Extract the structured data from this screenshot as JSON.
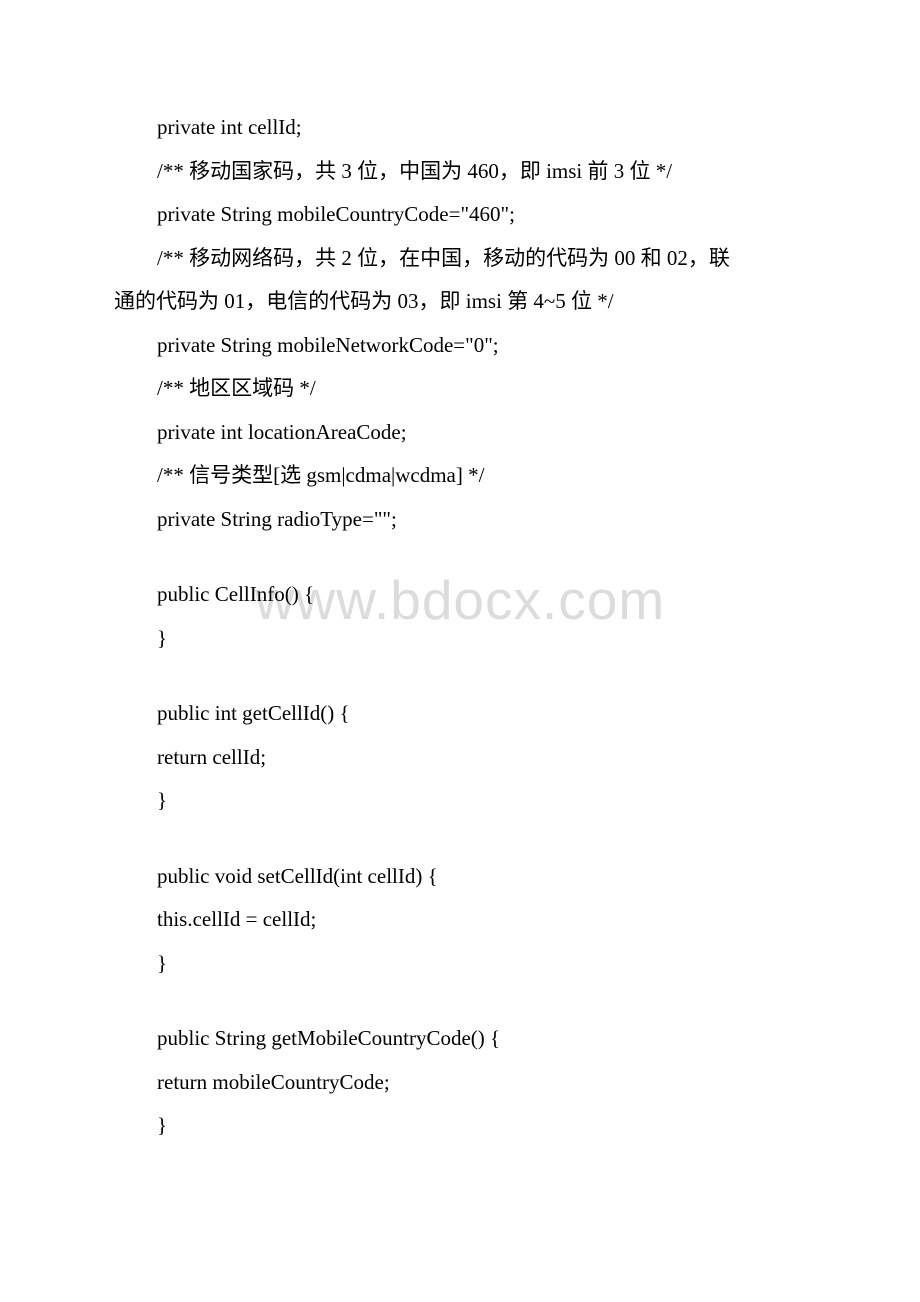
{
  "watermark": "www.bdocx.com",
  "lines": {
    "l1": "private int cellId;",
    "l2": "/** 移动国家码，共 3 位，中国为 460，即 imsi 前 3 位 */",
    "l3": "private String mobileCountryCode=\"460\";",
    "l4a": "/** 移动网络码，共 2 位，在中国，移动的代码为 00 和 02，联",
    "l4b": "通的代码为 01，电信的代码为 03，即 imsi 第 4~5 位 */",
    "l5": "private String mobileNetworkCode=\"0\";",
    "l6": "/** 地区区域码 */",
    "l7": "private int locationAreaCode;",
    "l8": "/** 信号类型[选 gsm|cdma|wcdma] */",
    "l9": "private String radioType=\"\";",
    "l10": "public CellInfo() {",
    "l11": "}",
    "l12": "public int getCellId() {",
    "l13": " return cellId;",
    "l14": "}",
    "l15": "public void setCellId(int cellId) {",
    "l16": " this.cellId = cellId;",
    "l17": "}",
    "l18": "public String getMobileCountryCode() {",
    "l19": " return mobileCountryCode;",
    "l20": "}"
  }
}
